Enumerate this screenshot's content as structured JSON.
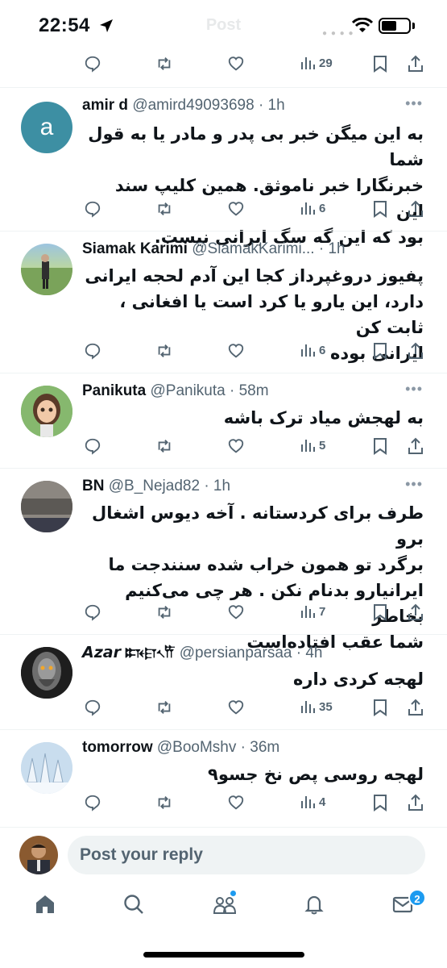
{
  "status_bar": {
    "time": "22:54",
    "ghost_title": "Post"
  },
  "top_actions": {
    "views": "29"
  },
  "tweets": [
    {
      "name": "amir d",
      "handle": "@amird49093698",
      "time": "· 1h",
      "avatar_letter": "a",
      "avatar_color": "#3d8fa3",
      "lines": [
        "به این میگن خبر بی پدر و مادر یا به قول شما",
        "خبرنگارا خبر ناموثق. همین کلیپ سند این",
        "بود که این گه سگ ایرانی نیست."
      ],
      "views": "6"
    },
    {
      "name": "Siamak Karimi",
      "handle": "@SiamakKarimi...",
      "time": "· 1h",
      "lines": [
        "پفیوز دروغپرداز کجا این آدم لحجه ایرانی",
        "دارد، این یارو یا کرد است یا افغانی ، ثابت کن",
        "ایرانی بوده"
      ],
      "views": "6"
    },
    {
      "name": "Panikuta",
      "handle": "@Panikuta",
      "time": "· 58m",
      "lines": [
        "به لهجش میاد ترک باشه"
      ],
      "views": "5"
    },
    {
      "name": "BN",
      "handle": "@B_Nejad82",
      "time": "· 1h",
      "lines": [
        "طرف برای کردستانه . آخه دیوس اشغال برو",
        "برگرد تو همون خراب شده سنندجت ما",
        "ایرانیارو بدنام نکن . هر چی می‌کنیم بخاطر",
        "شما عقب افتاده‌است"
      ],
      "views": "7"
    },
    {
      "name": "𝘼𝙯𝙖𝙧 𐏈𐎼𐏐𐎡",
      "handle": "@persianparsaa",
      "time": "· 4h",
      "lines": [
        "لهجه کردی داره"
      ],
      "views": "35"
    },
    {
      "name": "tomorrow",
      "handle": "@BooMshv",
      "time": "· 36m",
      "lines": [
        "لهجه روسی پص نخ جسو۹"
      ],
      "views": "4"
    }
  ],
  "reply": {
    "placeholder": "Post your reply"
  },
  "nav": {
    "messages_badge": "2"
  },
  "colors": {
    "accent": "#1d9bf0",
    "muted": "#536471",
    "text": "#0f1419"
  }
}
